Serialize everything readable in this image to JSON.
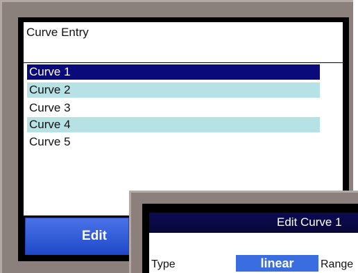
{
  "screen": {
    "title": "Curve Entry",
    "list": [
      "Curve 1",
      "Curve 2",
      "Curve 3",
      "Curve 4",
      "Curve 5"
    ],
    "selected_index": 0,
    "edit_label": "Edit"
  },
  "dialog": {
    "title": "Edit Curve 1",
    "type_label": "Type",
    "type_value": "linear",
    "range_label": "Range"
  }
}
